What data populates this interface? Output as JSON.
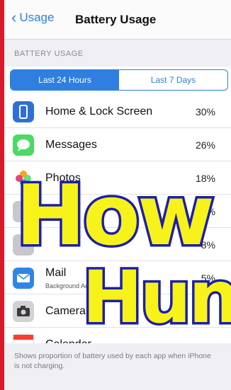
{
  "nav": {
    "back_label": "Usage",
    "title": "Battery Usage"
  },
  "section_header": "BATTERY USAGE",
  "tabs": [
    {
      "label": "Last 24 Hours",
      "active": true
    },
    {
      "label": "Last 7 Days",
      "active": false
    }
  ],
  "apps": [
    {
      "name": "Home & Lock Screen",
      "percent": "30%",
      "icon": "home-lock-screen-icon",
      "color": "#2f6fd6"
    },
    {
      "name": "Messages",
      "percent": "26%",
      "icon": "messages-icon",
      "color": "#4cd964"
    },
    {
      "name": "Photos",
      "percent": "18%",
      "icon": "photos-icon",
      "color": "#f5a623"
    },
    {
      "name": "",
      "percent": "10%",
      "icon": "app-icon",
      "color": "#8e8e93"
    },
    {
      "name": "",
      "percent": "8%",
      "icon": "app-icon",
      "color": "#8e8e93"
    },
    {
      "name": "Mail",
      "subtitle": "Background Activity",
      "percent": "5%",
      "icon": "mail-icon",
      "color": "#2f86e6"
    },
    {
      "name": "Camera",
      "percent": "",
      "icon": "camera-icon",
      "color": "#3a3a3c"
    },
    {
      "name": "Calendar",
      "percent": "",
      "icon": "calendar-icon",
      "color": "#ffffff"
    }
  ],
  "footer_note": "Shows proportion of battery used by each app when iPhone is not charging.",
  "overlay": {
    "line1": "How",
    "line2": "Hun",
    "fill": "#f7f21a",
    "stroke": "#1b1fa8"
  },
  "colors": {
    "accent": "#2f7fe0",
    "left_strip": "#d81b2a"
  }
}
